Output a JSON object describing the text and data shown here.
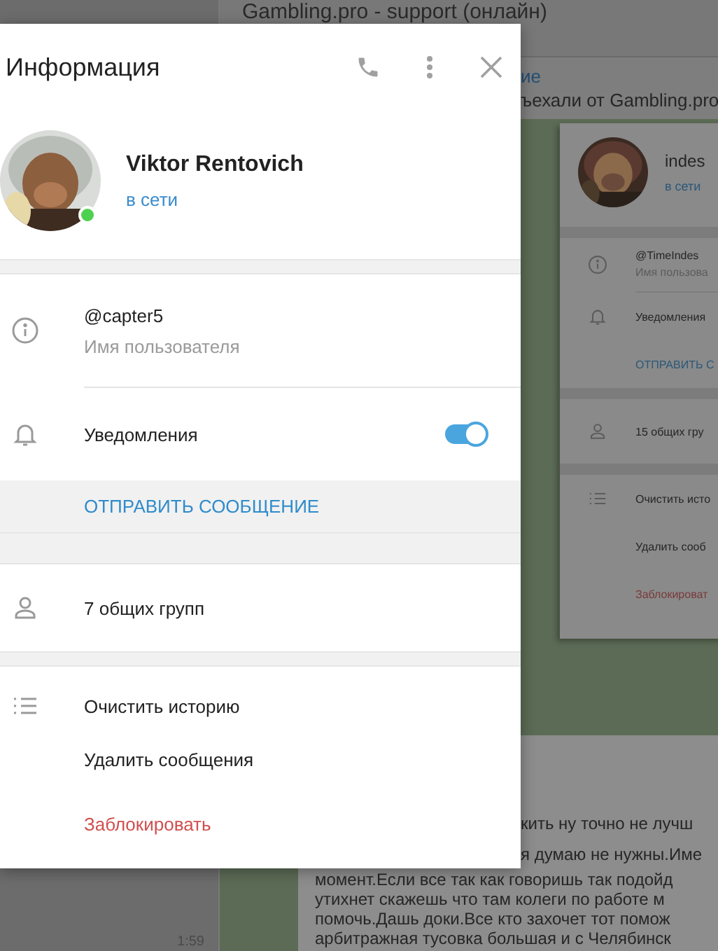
{
  "background_chat": {
    "title": "Gambling.pro - support (онлайн)",
    "pinned": {
      "label": "ие",
      "text": "ъехали от Gambling.pro"
    },
    "message_lines": [
      {
        "kind": "partial",
        "text": "кить ну точно не лучш"
      },
      {
        "kind": "partial",
        "text": "я думаю не нужны.Име"
      },
      {
        "kind": "full",
        "text": "момент.Если все так как говоришь так подойд"
      },
      {
        "kind": "full",
        "text": "утихнет скажешь что там колеги по работе м"
      },
      {
        "kind": "full",
        "text": "помочь.Дашь доки.Все кто захочет тот помож"
      },
      {
        "kind": "full",
        "text": "арбитражная тусовка большая и с Челябинск"
      }
    ],
    "time": "1:59"
  },
  "background_info": {
    "name": "indes",
    "status": "в сети",
    "username": "@TimeIndes",
    "username_label": "Имя пользова",
    "notifications_label": "Уведомления",
    "send_message": "ОТПРАВИТЬ С",
    "groups": "15 общих гру",
    "actions": [
      {
        "kind": "normal",
        "label": "Очистить исто"
      },
      {
        "kind": "normal",
        "label": "Удалить сооб"
      },
      {
        "kind": "danger",
        "label": "Заблокироват"
      }
    ]
  },
  "dialog": {
    "title": "Информация",
    "name": "Viktor Rentovich",
    "status": "в сети",
    "online": true,
    "username": "@capter5",
    "username_label": "Имя пользователя",
    "notifications": {
      "label": "Уведомления",
      "on": true
    },
    "send_message": "ОТПРАВИТЬ СООБЩЕНИЕ",
    "groups": "7 общих групп",
    "actions": [
      {
        "kind": "normal",
        "label": "Очистить историю"
      },
      {
        "kind": "normal",
        "label": "Удалить сообщения"
      },
      {
        "kind": "danger",
        "label": "Заблокировать"
      }
    ]
  }
}
